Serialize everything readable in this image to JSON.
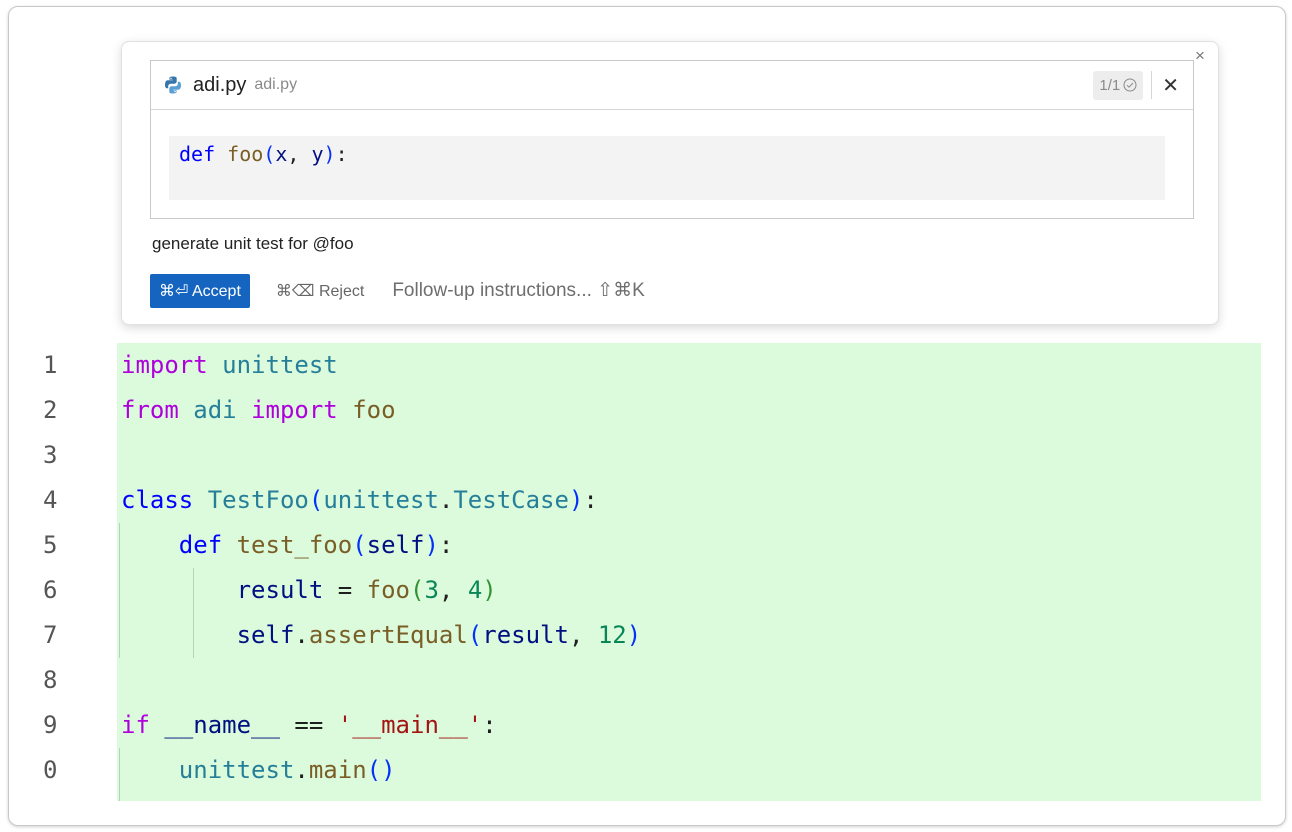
{
  "popup": {
    "peek": {
      "file_name": "adi.py",
      "file_path": "adi.py",
      "count": "1/1",
      "preview_code": [
        {
          "t": "def",
          "c": "kwb"
        },
        {
          "t": " "
        },
        {
          "t": "foo",
          "c": "fn"
        },
        {
          "t": "(",
          "c": "par1"
        },
        {
          "t": "x",
          "c": "var"
        },
        {
          "t": ", "
        },
        {
          "t": "y",
          "c": "var"
        },
        {
          "t": ")",
          "c": "par1"
        },
        {
          "t": ":"
        }
      ]
    },
    "prompt": "generate unit test for @foo",
    "accept_label": "⌘⏎ Accept",
    "reject_label": "⌘⌫ Reject",
    "followup_placeholder": "Follow-up instructions... ⇧⌘K"
  },
  "editor": {
    "lines": [
      {
        "num": "1",
        "tokens": [
          {
            "t": "import",
            "c": "kw"
          },
          {
            "t": " "
          },
          {
            "t": "unittest",
            "c": "ty"
          }
        ]
      },
      {
        "num": "2",
        "tokens": [
          {
            "t": "from",
            "c": "kw"
          },
          {
            "t": " "
          },
          {
            "t": "adi",
            "c": "ty"
          },
          {
            "t": " "
          },
          {
            "t": "import",
            "c": "kw"
          },
          {
            "t": " "
          },
          {
            "t": "foo",
            "c": "fn"
          }
        ]
      },
      {
        "num": "3",
        "tokens": []
      },
      {
        "num": "4",
        "tokens": [
          {
            "t": "class",
            "c": "kwb"
          },
          {
            "t": " "
          },
          {
            "t": "TestFoo",
            "c": "ty"
          },
          {
            "t": "(",
            "c": "par1"
          },
          {
            "t": "unittest",
            "c": "ty"
          },
          {
            "t": "."
          },
          {
            "t": "TestCase",
            "c": "ty"
          },
          {
            "t": ")",
            "c": "par1"
          },
          {
            "t": ":"
          }
        ]
      },
      {
        "num": "5",
        "tokens": [
          {
            "t": "    "
          },
          {
            "t": "def",
            "c": "kwb"
          },
          {
            "t": " "
          },
          {
            "t": "test_foo",
            "c": "fn"
          },
          {
            "t": "(",
            "c": "par1"
          },
          {
            "t": "self",
            "c": "var"
          },
          {
            "t": ")",
            "c": "par1"
          },
          {
            "t": ":"
          }
        ]
      },
      {
        "num": "6",
        "tokens": [
          {
            "t": "        "
          },
          {
            "t": "result",
            "c": "var"
          },
          {
            "t": " = "
          },
          {
            "t": "foo",
            "c": "fn"
          },
          {
            "t": "(",
            "c": "par2"
          },
          {
            "t": "3",
            "c": "num"
          },
          {
            "t": ", "
          },
          {
            "t": "4",
            "c": "num"
          },
          {
            "t": ")",
            "c": "par2"
          }
        ]
      },
      {
        "num": "7",
        "tokens": [
          {
            "t": "        "
          },
          {
            "t": "self",
            "c": "var"
          },
          {
            "t": "."
          },
          {
            "t": "assertEqual",
            "c": "fn"
          },
          {
            "t": "(",
            "c": "par1"
          },
          {
            "t": "result",
            "c": "var"
          },
          {
            "t": ", "
          },
          {
            "t": "12",
            "c": "num"
          },
          {
            "t": ")",
            "c": "par1"
          }
        ]
      },
      {
        "num": "8",
        "tokens": []
      },
      {
        "num": "9",
        "tokens": [
          {
            "t": "if",
            "c": "kw"
          },
          {
            "t": " "
          },
          {
            "t": "__name__",
            "c": "var"
          },
          {
            "t": " == "
          },
          {
            "t": "'__main__'",
            "c": "str"
          },
          {
            "t": ":"
          }
        ]
      },
      {
        "num": "0",
        "tokens": [
          {
            "t": "    "
          },
          {
            "t": "unittest",
            "c": "ty"
          },
          {
            "t": "."
          },
          {
            "t": "main",
            "c": "fn"
          },
          {
            "t": "(",
            "c": "par1"
          },
          {
            "t": ")",
            "c": "par1"
          }
        ]
      }
    ]
  },
  "colors": {
    "accent": "#1565c0",
    "diff_added_bg": "#dcfadc"
  },
  "icons": {
    "file": "python-file-icon",
    "count": "check-circle-icon",
    "close": "close-icon"
  }
}
